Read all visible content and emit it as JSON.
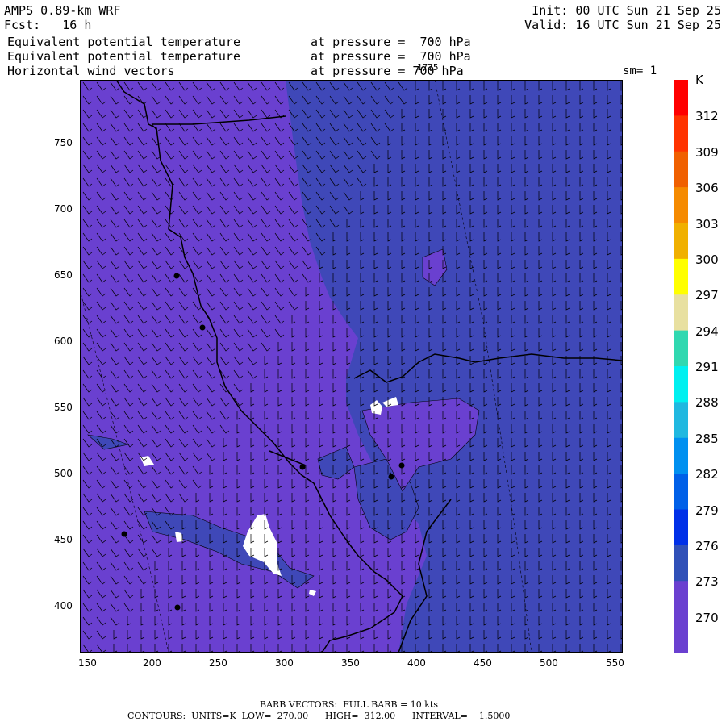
{
  "header": {
    "model": "AMPS 0.89-km WRF",
    "fcst": "Fcst:   16 h",
    "init": "Init: 00 UTC Sun 21 Sep 25",
    "valid": "Valid: 16 UTC Sun 21 Sep 25",
    "field1": "Equivalent potential temperature",
    "field1_level": "at pressure =  700 hPa",
    "field2": "Equivalent potential temperature",
    "field2_level": "at pressure =  700 hPa",
    "field3": "Horizontal wind vectors",
    "field3_level": "at pressure = 700 hPa",
    "overlay_text": "1775",
    "smooth": "sm= 1"
  },
  "axes": {
    "x_ticks": [
      "150",
      "200",
      "250",
      "300",
      "350",
      "400",
      "450",
      "500",
      "550"
    ],
    "y_ticks": [
      "750",
      "700",
      "650",
      "600",
      "550",
      "500",
      "450",
      "400"
    ]
  },
  "colorbar": {
    "unit": "K",
    "levels": [
      "312",
      "309",
      "306",
      "303",
      "300",
      "297",
      "294",
      "291",
      "288",
      "285",
      "282",
      "279",
      "276",
      "273",
      "270"
    ],
    "colors": [
      "#ff0000",
      "#ff3300",
      "#f06000",
      "#f58a00",
      "#f0b000",
      "#ffff00",
      "#e8e0a0",
      "#30d8b0",
      "#00f0f0",
      "#20b8e0",
      "#0090f0",
      "#0060e8",
      "#0030e8",
      "#3050b8",
      "#6a40d0",
      "#6a40d0"
    ]
  },
  "map_colors": {
    "west_fill": "#6a40d0",
    "east_fill": "#3f48b8",
    "missing": "#ffffff"
  },
  "footer": {
    "barb": "BARB VECTORS:  FULL BARB = 10 kts",
    "contours": "CONTOURS:  UNITS=K  LOW=  270.00      HIGH=  312.00      INTERVAL=    1.5000"
  }
}
